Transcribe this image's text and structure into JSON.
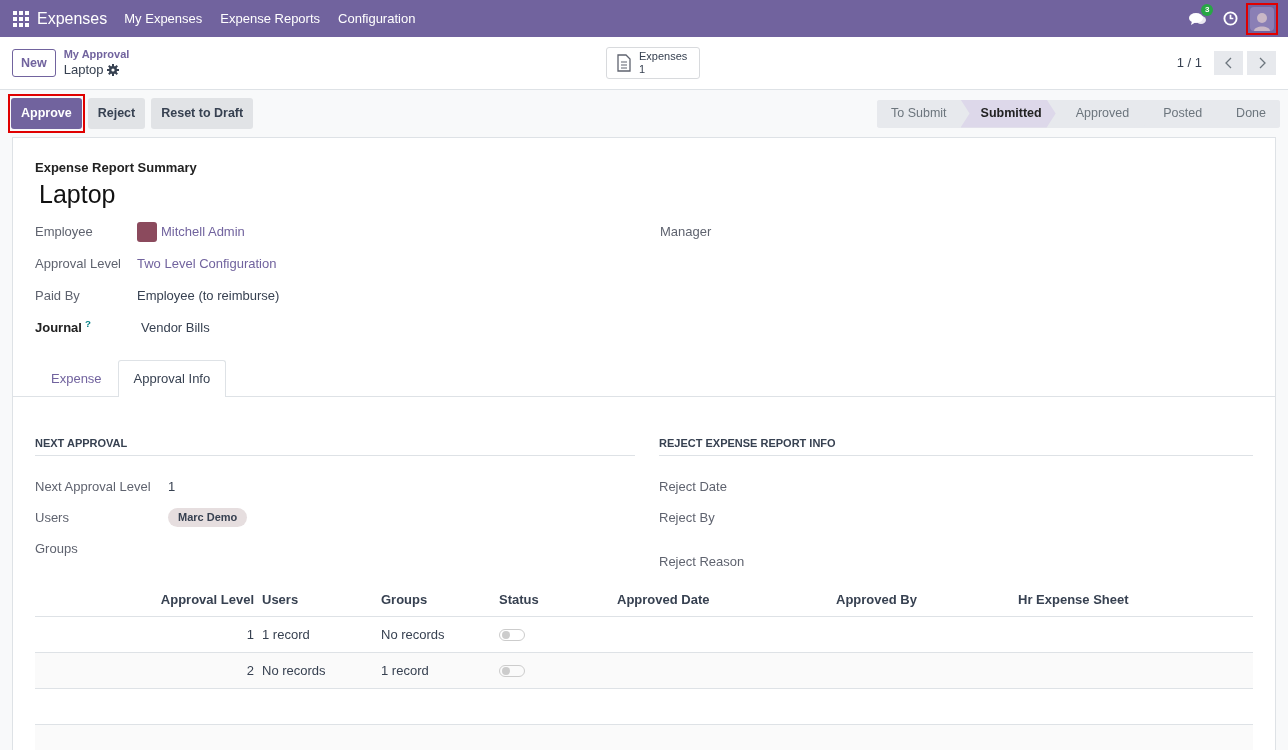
{
  "navbar": {
    "app": "Expenses",
    "menus": [
      "My Expenses",
      "Expense Reports",
      "Configuration"
    ],
    "chat_badge": "3",
    "avatar_highlighted": true
  },
  "breadcrumb": {
    "parent": "My Approval",
    "current": "Laptop"
  },
  "new_button": "New",
  "smart_button": {
    "label": "Expenses",
    "count": "1"
  },
  "pager": "1 / 1",
  "actions": [
    {
      "label": "Approve",
      "kind": "primary",
      "highlighted": true
    },
    {
      "label": "Reject",
      "kind": "secondary",
      "highlighted": false
    },
    {
      "label": "Reset to Draft",
      "kind": "secondary",
      "highlighted": false
    }
  ],
  "status_steps": [
    {
      "label": "To Submit",
      "selected": false
    },
    {
      "label": "Submitted",
      "selected": true
    },
    {
      "label": "Approved",
      "selected": false
    },
    {
      "label": "Posted",
      "selected": false
    },
    {
      "label": "Done",
      "selected": false
    }
  ],
  "sheet": {
    "caption": "Expense Report Summary",
    "title": "Laptop",
    "left_fields": [
      {
        "label": "Employee",
        "value": "Mitchell Admin",
        "kind": "avatar-link",
        "bold": false
      },
      {
        "label": "Approval Level",
        "value": "Two Level Configuration",
        "kind": "link",
        "bold": false
      },
      {
        "label": "Paid By",
        "value": "Employee (to reimburse)",
        "kind": "text",
        "bold": false
      },
      {
        "label": "Journal",
        "help": "?",
        "value": "Vendor Bills",
        "kind": "text",
        "bold": true
      }
    ],
    "right_fields": [
      {
        "label": "Manager"
      }
    ],
    "tabs": [
      {
        "label": "Expense",
        "selected": false
      },
      {
        "label": "Approval Info",
        "selected": true
      }
    ],
    "next_approval": {
      "heading": "NEXT APPROVAL",
      "fields": [
        {
          "label": "Next Approval Level",
          "value": "1",
          "kind": "text"
        },
        {
          "label": "Users",
          "value": "Marc Demo",
          "kind": "tag"
        },
        {
          "label": "Groups",
          "kind": "empty"
        }
      ]
    },
    "reject_info": {
      "heading": "REJECT EXPENSE REPORT INFO",
      "fields": [
        {
          "label": "Reject Date"
        },
        {
          "label": "Reject By"
        },
        {
          "label": "Reject Reason"
        }
      ]
    },
    "table": {
      "columns": [
        "Approval Level",
        "Users",
        "Groups",
        "Status",
        "Approved Date",
        "Approved By",
        "Hr Expense Sheet"
      ],
      "rows": [
        {
          "level": "1",
          "users": "1 record",
          "groups": "No records",
          "status_on": false
        },
        {
          "level": "2",
          "users": "No records",
          "groups": "1 record",
          "status_on": false
        }
      ]
    }
  }
}
